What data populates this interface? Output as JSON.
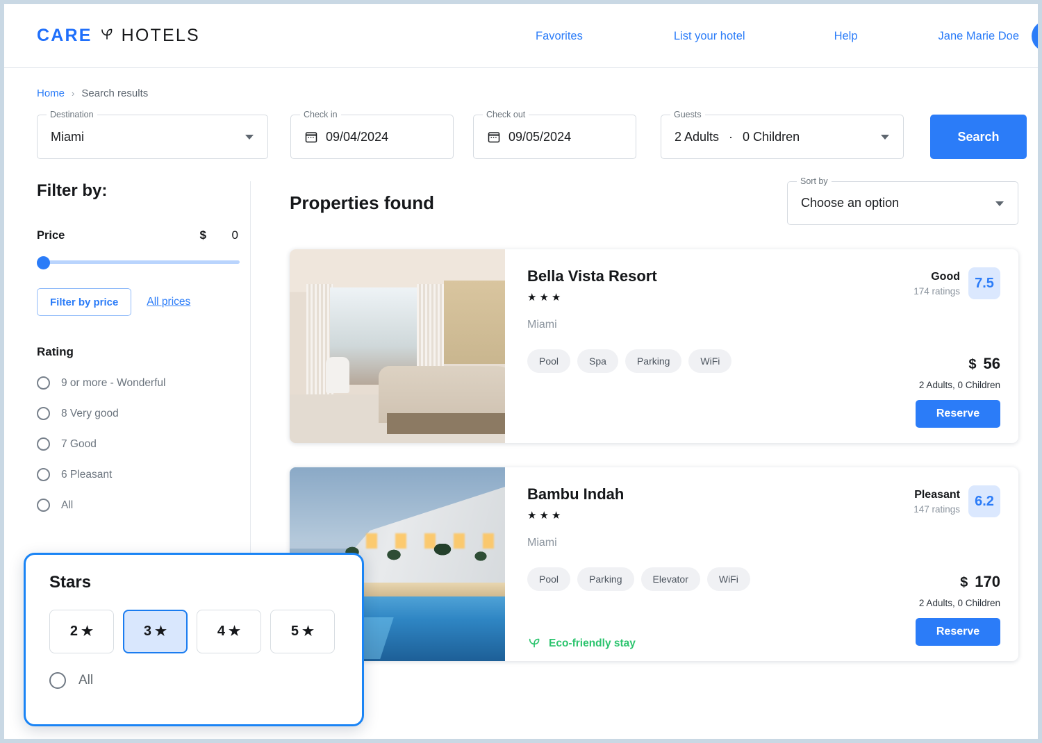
{
  "header": {
    "logo": {
      "brand": "CARE",
      "suffix": "HOTELS",
      "icon": "leaf-icon"
    },
    "nav": [
      {
        "label": "Favorites"
      },
      {
        "label": "List your hotel"
      },
      {
        "label": "Help"
      },
      {
        "label": "Jane Marie Doe"
      }
    ],
    "avatar_icon": "person-icon"
  },
  "breadcrumb": {
    "home": "Home",
    "separator": "›",
    "current": "Search results"
  },
  "search": {
    "destination": {
      "label": "Destination",
      "value": "Miami"
    },
    "check_in": {
      "label": "Check in",
      "value": "09/04/2024",
      "icon": "calendar-icon"
    },
    "check_out": {
      "label": "Check out",
      "value": "09/05/2024",
      "icon": "calendar-icon"
    },
    "guests": {
      "label": "Guests",
      "adults": "2  Adults",
      "separator": "·",
      "children": "0  Children"
    },
    "search_button": "Search"
  },
  "filters": {
    "title": "Filter by:",
    "price": {
      "label": "Price",
      "currency": "$",
      "value": "0",
      "slider_percent": 0,
      "filter_button": "Filter by price",
      "all_link": "All prices"
    },
    "rating": {
      "title": "Rating",
      "options": [
        {
          "label": "9 or more -  Wonderful",
          "selected": false
        },
        {
          "label": "8 Very good",
          "selected": false
        },
        {
          "label": "7 Good",
          "selected": false
        },
        {
          "label": "6 Pleasant",
          "selected": false
        },
        {
          "label": "All",
          "selected": false
        }
      ]
    },
    "stars_panel": {
      "title": "Stars",
      "options": [
        {
          "count": "2",
          "glyph": "★",
          "selected": false
        },
        {
          "count": "3",
          "glyph": "★",
          "selected": true
        },
        {
          "count": "4",
          "glyph": "★",
          "selected": false
        },
        {
          "count": "5",
          "glyph": "★",
          "selected": false
        }
      ],
      "all_label": "All"
    }
  },
  "results": {
    "heading": "Properties found",
    "sort": {
      "label": "Sort by",
      "value": "Choose an option"
    },
    "cards": [
      {
        "name": "Bella Vista Resort",
        "stars": "★★★",
        "city": "Miami",
        "amenities": [
          "Pool",
          "Spa",
          "Parking",
          "WiFi"
        ],
        "score_title": "Good",
        "ratings": "174 ratings",
        "score": "7.5",
        "price_symbol": "$",
        "price": "56",
        "occupancy": "2 Adults,  0 Children",
        "reserve": "Reserve",
        "eco": null,
        "image": "hotel-bedroom-photo"
      },
      {
        "name": "Bambu Indah",
        "stars": "★★★",
        "city": "Miami",
        "amenities": [
          "Pool",
          "Parking",
          "Elevator",
          "WiFi"
        ],
        "score_title": "Pleasant",
        "ratings": "147 ratings",
        "score": "6.2",
        "price_symbol": "$",
        "price": "170",
        "occupancy": "2 Adults,  0 Children",
        "reserve": "Reserve",
        "eco": "Eco-friendly stay",
        "image": "resort-pool-photo"
      }
    ]
  },
  "colors": {
    "accent": "#2b7cf8",
    "accent_light": "#dbe8fe",
    "eco_green": "#2cc46e",
    "page_border": "#c9d8e4"
  }
}
